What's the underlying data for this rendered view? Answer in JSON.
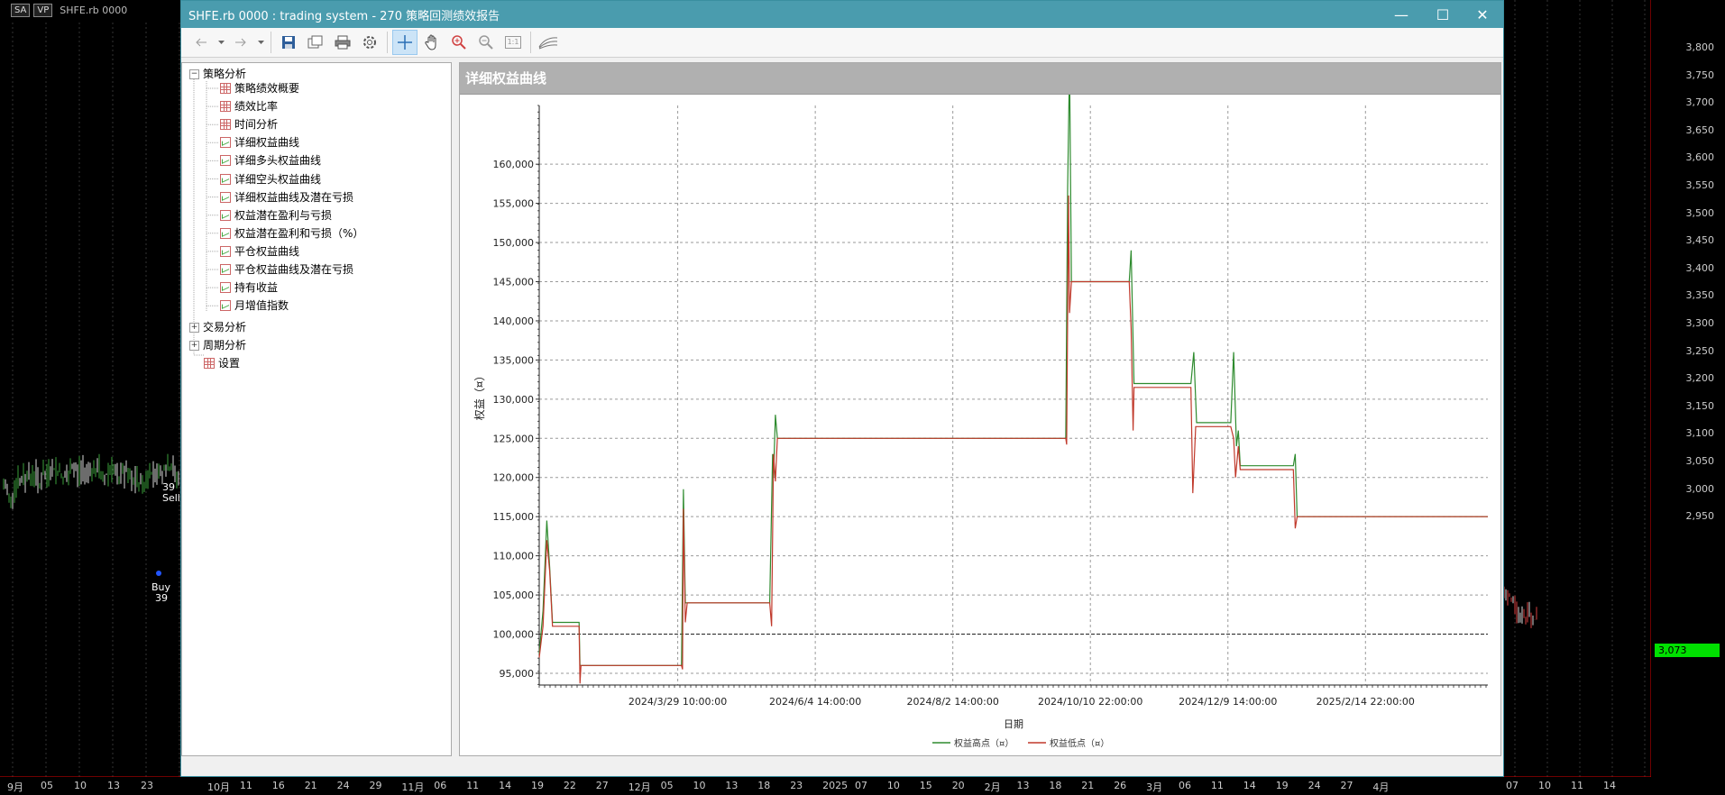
{
  "background": {
    "header": {
      "sa": "SA",
      "vp": "VP",
      "symbol": "SHFE.rb 0000"
    },
    "price_ticks": [
      "3,800",
      "3,750",
      "3,700",
      "3,650",
      "3,600",
      "3,550",
      "3,500",
      "3,450",
      "3,400",
      "3,350",
      "3,300",
      "3,250",
      "3,200",
      "3,150",
      "3,100",
      "3,050",
      "3,000",
      "2,950"
    ],
    "current_price": "3,073",
    "date_ticks_left": [
      "9月",
      "05",
      "10",
      "13",
      "23"
    ],
    "date_ticks_mid": [
      "10月",
      "11",
      "16",
      "21",
      "24",
      "29",
      "11月",
      "06",
      "11",
      "14",
      "19",
      "22",
      "27",
      "12月",
      "05",
      "10",
      "13",
      "18",
      "23",
      "2025",
      "07",
      "10",
      "15",
      "20",
      "2月",
      "13",
      "18",
      "21",
      "26",
      "3月",
      "06",
      "11",
      "14",
      "19",
      "24",
      "27",
      "4月"
    ],
    "date_ticks_right": [
      "07",
      "10",
      "11",
      "14"
    ],
    "trade_labels": {
      "sell_count": "39",
      "sell": "Sell",
      "buy": "Buy",
      "buy_count": "39"
    }
  },
  "window": {
    "title": "SHFE.rb 0000 : trading system - 270 策略回测绩效报告",
    "controls": {
      "minimize": "—",
      "maximize": "☐",
      "close": "✕"
    }
  },
  "toolbar": {
    "icons": [
      "back-icon",
      "forward-icon",
      "save-icon",
      "copy-icon",
      "print-icon",
      "settings-icon",
      "crosshair-icon",
      "hand-icon",
      "zoom-in-icon",
      "zoom-out-icon",
      "zoom-reset-icon",
      "chart-style-icon"
    ],
    "zoom_reset_label": "1:1"
  },
  "tree": {
    "root": "策略分析",
    "items": [
      "策略绩效概要",
      "绩效比率",
      "时间分析",
      "详细权益曲线",
      "详细多头权益曲线",
      "详细空头权益曲线",
      "详细权益曲线及潜在亏损",
      "权益潜在盈利与亏损",
      "权益潜在盈利和亏损（%）",
      "平仓权益曲线",
      "平仓权益曲线及潜在亏损",
      "持有收益",
      "月增值指数"
    ],
    "item_icons": [
      "grid",
      "grid",
      "grid",
      "chart",
      "chart",
      "chart",
      "chart",
      "chart",
      "chart",
      "chart",
      "chart",
      "chart",
      "chart"
    ],
    "groups": [
      "交易分析",
      "周期分析"
    ],
    "settings": "设置"
  },
  "panel": {
    "title": "详细权益曲线"
  },
  "chart_data": {
    "type": "line",
    "xlabel": "日期",
    "ylabel": "权益（¤）",
    "ylim": [
      93500,
      167500
    ],
    "yticks": [
      95000,
      100000,
      105000,
      110000,
      115000,
      120000,
      125000,
      130000,
      135000,
      140000,
      145000,
      150000,
      155000,
      160000
    ],
    "ytick_labels": [
      "95,000",
      "100,000",
      "105,000",
      "110,000",
      "115,000",
      "120,000",
      "125,000",
      "130,000",
      "135,000",
      "140,000",
      "145,000",
      "150,000",
      "155,000",
      "160,000"
    ],
    "xtick_labels": [
      "2024/3/29 10:00:00",
      "2024/6/4 14:00:00",
      "2024/8/2 14:00:00",
      "2024/10/10 22:00:00",
      "2024/12/9 14:00:00",
      "2025/2/14 22:00:00"
    ],
    "xtick_pos": [
      0.146,
      0.291,
      0.436,
      0.581,
      0.726,
      0.871
    ],
    "reference_line": 100000,
    "grid": true,
    "legend_position": "bottom-center",
    "series": [
      {
        "name": "权益高点（¤）",
        "color": "#2e8b2e",
        "points": [
          [
            0,
            97500
          ],
          [
            0.004,
            103000
          ],
          [
            0.008,
            114500
          ],
          [
            0.011,
            108500
          ],
          [
            0.014,
            101500
          ],
          [
            0.042,
            101500
          ],
          [
            0.043,
            96000
          ],
          [
            0.15,
            96000
          ],
          [
            0.152,
            118500
          ],
          [
            0.154,
            104000
          ],
          [
            0.243,
            104000
          ],
          [
            0.246,
            123000
          ],
          [
            0.247,
            120000
          ],
          [
            0.249,
            128000
          ],
          [
            0.251,
            125000
          ],
          [
            0.555,
            125000
          ],
          [
            0.557,
            157000
          ],
          [
            0.559,
            173000
          ],
          [
            0.561,
            145000
          ],
          [
            0.622,
            145000
          ],
          [
            0.624,
            149000
          ],
          [
            0.627,
            132000
          ],
          [
            0.687,
            132000
          ],
          [
            0.69,
            136000
          ],
          [
            0.693,
            127000
          ],
          [
            0.729,
            127000
          ],
          [
            0.732,
            136000
          ],
          [
            0.735,
            124000
          ],
          [
            0.737,
            126000
          ],
          [
            0.739,
            121500
          ],
          [
            0.795,
            121500
          ],
          [
            0.797,
            123000
          ],
          [
            0.799,
            115000
          ],
          [
            1.0,
            115000
          ]
        ]
      },
      {
        "name": "权益低点（¤）",
        "color": "#c0392b",
        "points": [
          [
            0,
            97000
          ],
          [
            0.004,
            101000
          ],
          [
            0.008,
            112000
          ],
          [
            0.011,
            108000
          ],
          [
            0.014,
            101000
          ],
          [
            0.042,
            101000
          ],
          [
            0.043,
            93700
          ],
          [
            0.044,
            96000
          ],
          [
            0.15,
            96000
          ],
          [
            0.151,
            95500
          ],
          [
            0.152,
            116000
          ],
          [
            0.154,
            101500
          ],
          [
            0.156,
            104000
          ],
          [
            0.243,
            104000
          ],
          [
            0.245,
            101000
          ],
          [
            0.247,
            123000
          ],
          [
            0.249,
            119500
          ],
          [
            0.251,
            125000
          ],
          [
            0.555,
            125000
          ],
          [
            0.556,
            124200
          ],
          [
            0.558,
            156000
          ],
          [
            0.559,
            141000
          ],
          [
            0.561,
            145000
          ],
          [
            0.622,
            145000
          ],
          [
            0.624,
            139000
          ],
          [
            0.626,
            126000
          ],
          [
            0.627,
            131500
          ],
          [
            0.687,
            131500
          ],
          [
            0.689,
            118000
          ],
          [
            0.692,
            126500
          ],
          [
            0.729,
            126500
          ],
          [
            0.732,
            125000
          ],
          [
            0.734,
            120000
          ],
          [
            0.737,
            124000
          ],
          [
            0.739,
            121000
          ],
          [
            0.795,
            121000
          ],
          [
            0.797,
            113500
          ],
          [
            0.799,
            115000
          ],
          [
            1.0,
            115000
          ]
        ]
      }
    ]
  }
}
